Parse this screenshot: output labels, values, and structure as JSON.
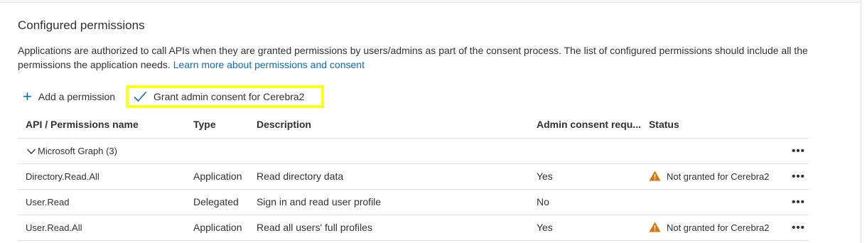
{
  "section": {
    "title": "Configured permissions",
    "description": "Applications are authorized to call APIs when they are granted permissions by users/admins as part of the consent process. The list of configured permissions should include all the permissions the application needs.",
    "learn_more_link": "Learn more about permissions and consent"
  },
  "toolbar": {
    "add_label": "Add a permission",
    "grant_label": "Grant admin consent for Cerebra2"
  },
  "table": {
    "headers": {
      "api": "API / Permissions name",
      "type": "Type",
      "description": "Description",
      "admin": "Admin consent requ...",
      "status": "Status"
    },
    "group": {
      "label": "Microsoft Graph (3)",
      "more": "•••"
    },
    "rows": [
      {
        "name": "Directory.Read.All",
        "type": "Application",
        "description": "Read directory data",
        "admin": "Yes",
        "status": "Not granted for Cerebra2",
        "more": "•••"
      },
      {
        "name": "User.Read",
        "type": "Delegated",
        "description": "Sign in and read user profile",
        "admin": "No",
        "status": "",
        "more": "•••"
      },
      {
        "name": "User.Read.All",
        "type": "Application",
        "description": "Read all users' full profiles",
        "admin": "Yes",
        "status": "Not granted for Cerebra2",
        "more": "•••"
      }
    ]
  },
  "icons": {
    "add": "plus-icon",
    "grant": "checkmark-icon",
    "expand": "chevron-down-icon",
    "warning": "warning-icon",
    "more": "more-icon"
  },
  "colors": {
    "link": "#0f6cbd",
    "warning": "#d9730d",
    "highlight": "#ffff1a"
  }
}
